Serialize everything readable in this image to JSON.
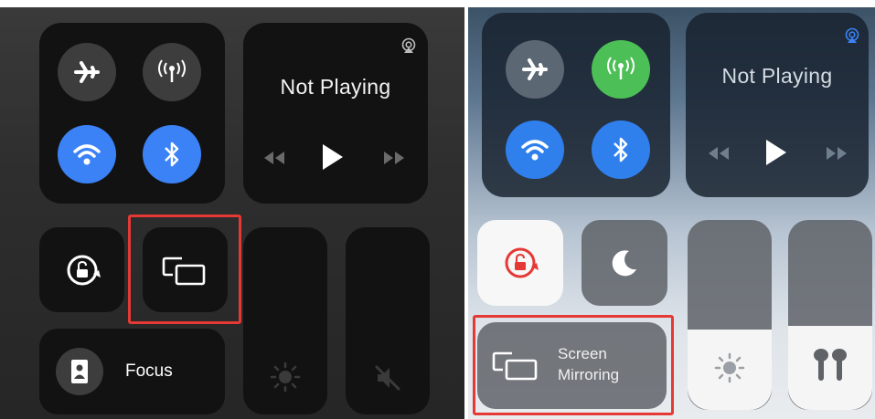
{
  "left_panel": {
    "now_playing": {
      "status": "Not Playing"
    },
    "focus": {
      "label": "Focus"
    }
  },
  "right_panel": {
    "now_playing": {
      "status": "Not Playing"
    },
    "screen_mirroring": {
      "line1": "Screen",
      "line2": "Mirroring"
    }
  },
  "colors": {
    "highlight": "#e53935",
    "wifi_blue": "#3b82f6",
    "cellular_green": "#4cbf56",
    "lock_red": "#e53935"
  },
  "icons": [
    "airplane-icon",
    "cellular-icon",
    "wifi-icon",
    "bluetooth-icon",
    "airplay-icon",
    "rewind-icon",
    "play-icon",
    "fast-forward-icon",
    "rotation-lock-icon",
    "screen-mirroring-icon",
    "focus-icon",
    "brightness-icon",
    "mute-icon",
    "moon-icon",
    "airpods-icon"
  ]
}
